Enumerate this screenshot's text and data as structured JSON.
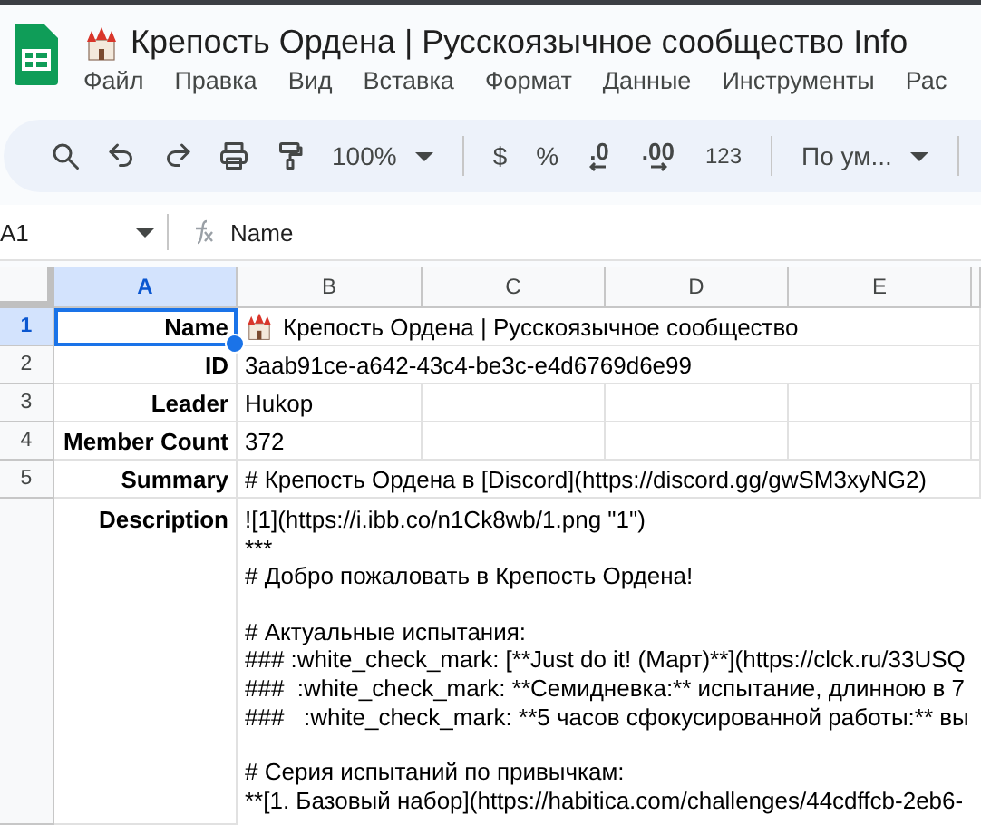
{
  "document": {
    "title": "Крепость Ордена | Русскоязычное сообщество Info"
  },
  "menu": [
    "Файл",
    "Правка",
    "Вид",
    "Вставка",
    "Формат",
    "Данные",
    "Инструменты",
    "Рас"
  ],
  "toolbar": {
    "zoom": "100%",
    "currency": "$",
    "percent": "%",
    "decrease_decimal": ".0",
    "increase_decimal": ".00",
    "number_format": "123",
    "font": "По ум..."
  },
  "formula_bar": {
    "cell_ref": "A1",
    "value": "Name"
  },
  "columns": [
    {
      "label": "A",
      "selected": true
    },
    {
      "label": "B",
      "selected": false
    },
    {
      "label": "C",
      "selected": false
    },
    {
      "label": "D",
      "selected": false
    },
    {
      "label": "E",
      "selected": false
    }
  ],
  "rows": [
    {
      "number": "1",
      "selected": true,
      "label": "Name",
      "value": "Крепость Ордена | Русскоязычное сообщество",
      "has_icon": true
    },
    {
      "number": "2",
      "selected": false,
      "label": "ID",
      "value": "3aab91ce-a642-43c4-be3c-e4d6769d6e99",
      "has_icon": false
    },
    {
      "number": "3",
      "selected": false,
      "label": "Leader",
      "value": "Hukop",
      "has_icon": false
    },
    {
      "number": "4",
      "selected": false,
      "label": "Member Count",
      "value": "372",
      "has_icon": false
    },
    {
      "number": "5",
      "selected": false,
      "label": "Summary",
      "value": "# Крепость Ордена в [Discord](https://discord.gg/gwSM3xyNG2)",
      "has_icon": false
    }
  ],
  "description": {
    "label": "Description",
    "paragraphs": [
      [
        "![1](https://i.ibb.co/n1Ck8wb/1.png \"1\")",
        "***",
        "# Добро пожаловать в Крепость Ордена!"
      ],
      [
        "# Актуальные испытания:",
        "### :white_check_mark: [**Just do it! (Март)**](https://clck.ru/33USQ",
        "###  :white_check_mark: **Семидневка:** испытание, длинною в 7",
        "###   :white_check_mark: **5 часов сфокусированной работы:** вы"
      ],
      [
        "# Серия испытаний по привычкам:",
        "**[1. Базовый набор](https://habitica.com/challenges/44cdffcb-2eb6-"
      ]
    ]
  }
}
